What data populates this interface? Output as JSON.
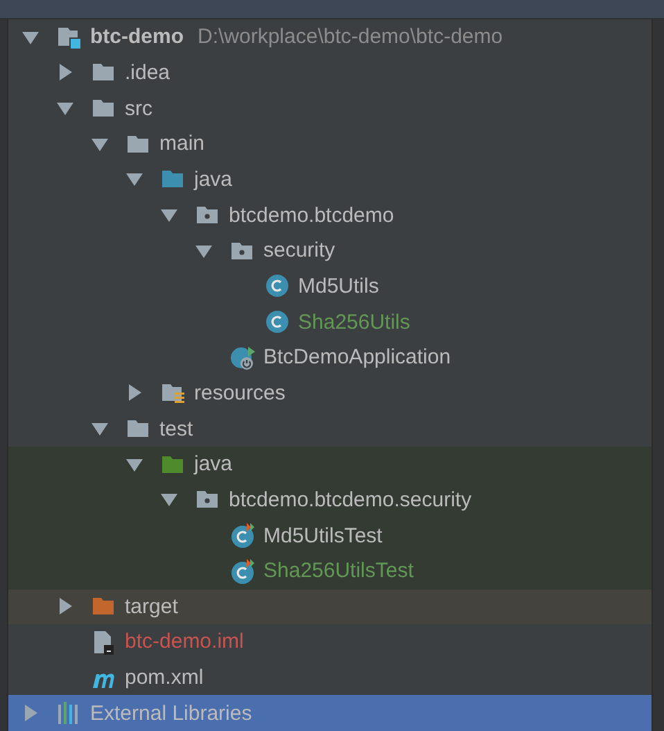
{
  "tree": [
    {
      "label": "btc-demo",
      "path": "D:\\workplace\\btc-demo\\btc-demo",
      "kind": "module",
      "expanded": true,
      "selected": false,
      "color": "#bbbbbb",
      "children": [
        {
          "label": ".idea",
          "kind": "folder",
          "expanded": false,
          "selected": false,
          "color": "#bbbbbb"
        },
        {
          "label": "src",
          "kind": "folder",
          "expanded": true,
          "selected": false,
          "color": "#bbbbbb",
          "children": [
            {
              "label": "main",
              "kind": "folder",
              "expanded": true,
              "selected": false,
              "color": "#bbbbbb",
              "children": [
                {
                  "label": "java",
                  "kind": "source-folder",
                  "expanded": true,
                  "selected": false,
                  "color": "#bbbbbb",
                  "children": [
                    {
                      "label": "btcdemo.btcdemo",
                      "kind": "package",
                      "expanded": true,
                      "selected": false,
                      "color": "#bbbbbb",
                      "children": [
                        {
                          "label": "security",
                          "kind": "package",
                          "expanded": true,
                          "selected": false,
                          "color": "#bbbbbb",
                          "children": [
                            {
                              "label": "Md5Utils",
                              "kind": "class",
                              "selected": false,
                              "color": "#bbbbbb"
                            },
                            {
                              "label": "Sha256Utils",
                              "kind": "class",
                              "selected": false,
                              "color": "#629755"
                            }
                          ]
                        },
                        {
                          "label": "BtcDemoApplication",
                          "kind": "app-class",
                          "selected": false,
                          "color": "#bbbbbb"
                        }
                      ]
                    }
                  ]
                },
                {
                  "label": "resources",
                  "kind": "resources",
                  "expanded": false,
                  "selected": false,
                  "color": "#bbbbbb"
                }
              ]
            },
            {
              "label": "test",
              "kind": "folder",
              "expanded": true,
              "selected": false,
              "color": "#bbbbbb",
              "children": [
                {
                  "label": "java",
                  "kind": "test-folder",
                  "test_source": true,
                  "expanded": true,
                  "selected": false,
                  "color": "#bbbbbb",
                  "children": [
                    {
                      "label": "btcdemo.btcdemo.security",
                      "kind": "package",
                      "test_source": true,
                      "expanded": true,
                      "selected": false,
                      "color": "#bbbbbb",
                      "children": [
                        {
                          "label": "Md5UtilsTest",
                          "kind": "test-class",
                          "test_source": true,
                          "selected": false,
                          "color": "#bbbbbb"
                        },
                        {
                          "label": "Sha256UtilsTest",
                          "kind": "test-class",
                          "test_source": true,
                          "selected": false,
                          "color": "#629755"
                        }
                      ]
                    }
                  ]
                }
              ]
            }
          ]
        },
        {
          "label": "target",
          "kind": "excluded-folder",
          "excluded": true,
          "expanded": false,
          "selected": false,
          "color": "#bbbbbb"
        },
        {
          "label": "btc-demo.iml",
          "kind": "iml-file",
          "selected": false,
          "color": "#c75450"
        },
        {
          "label": "pom.xml",
          "kind": "maven-file",
          "selected": false,
          "color": "#bbbbbb"
        }
      ]
    },
    {
      "label": "External Libraries",
      "kind": "libraries",
      "expanded": false,
      "selected": true,
      "color": "#bbbbbb"
    }
  ]
}
